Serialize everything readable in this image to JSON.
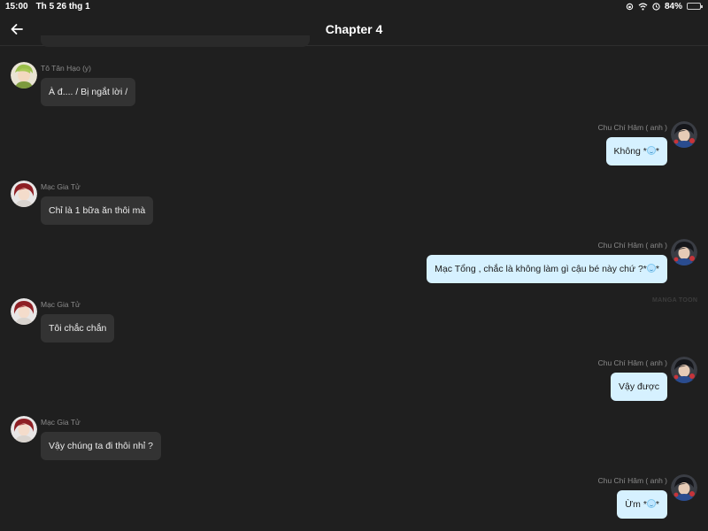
{
  "status_bar": {
    "time": "15:00",
    "date": "Th 5 26 thg 1",
    "battery_percent": "84%",
    "battery_level": 0.84
  },
  "header": {
    "title": "Chapter 4"
  },
  "messages": [
    {
      "side": "left",
      "sender": "Tô Tân Hạo (y)",
      "text": "À đ.... / Bị ngắt lời /",
      "avatar": "green-haired-boy"
    },
    {
      "side": "right",
      "sender": "Chu Chí Hâm ( anh )",
      "text": "Không *",
      "text_after": "*",
      "emoji": "smile-emoji",
      "avatar": "dark-haired-man"
    },
    {
      "side": "left",
      "sender": "Mạc Gia Tử",
      "text": "Chỉ là 1 bữa ăn thôi mà",
      "avatar": "red-haired-girl"
    },
    {
      "side": "right",
      "sender": "Chu Chí Hâm ( anh )",
      "text": "Mạc Tổng , chắc là không làm gì cậu bé này chứ ?*",
      "text_after": "*",
      "emoji": "smile-emoji",
      "avatar": "dark-haired-man"
    },
    {
      "side": "left",
      "sender": "Mạc Gia Tử",
      "text": "Tôi chắc chắn",
      "avatar": "red-haired-girl"
    },
    {
      "side": "right",
      "sender": "Chu Chí Hâm ( anh )",
      "text": "Vậy được",
      "avatar": "dark-haired-man"
    },
    {
      "side": "left",
      "sender": "Mạc Gia Tử",
      "text": "Vậy chúng ta đi thôi nhỉ ?",
      "avatar": "red-haired-girl"
    },
    {
      "side": "right",
      "sender": "Chu Chí Hâm ( anh )",
      "text": "Ừm *",
      "text_after": "*",
      "emoji": "smile-emoji",
      "avatar": "dark-haired-man"
    }
  ],
  "watermark": "MANGA TOON",
  "colors": {
    "background": "#1f1f1f",
    "left_bubble": "#333333",
    "right_bubble": "#d6f1ff",
    "battery": "#f2c200"
  }
}
